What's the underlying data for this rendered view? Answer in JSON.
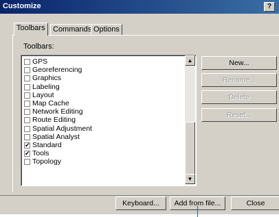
{
  "window": {
    "title": "Customize",
    "help_label": "?"
  },
  "tabs": [
    {
      "label": "Toolbars",
      "active": true
    },
    {
      "label": "Commands",
      "active": false
    },
    {
      "label": "Options",
      "active": false
    }
  ],
  "toolbars_label": "Toolbars:",
  "toolbar_items": [
    {
      "label": "GPS",
      "checked": false
    },
    {
      "label": "Georeferencing",
      "checked": false
    },
    {
      "label": "Graphics",
      "checked": false
    },
    {
      "label": "Labeling",
      "checked": false
    },
    {
      "label": "Layout",
      "checked": false
    },
    {
      "label": "Map Cache",
      "checked": false
    },
    {
      "label": "Network Editing",
      "checked": false
    },
    {
      "label": "Route Editing",
      "checked": false
    },
    {
      "label": "Spatial Adjustment",
      "checked": false
    },
    {
      "label": "Spatial Analyst",
      "checked": false
    },
    {
      "label": "Standard",
      "checked": true
    },
    {
      "label": "Tools",
      "checked": true
    },
    {
      "label": "Topology",
      "checked": false
    }
  ],
  "scrollbar": {
    "up": "▲",
    "down": "▼"
  },
  "side_buttons": {
    "new": "New...",
    "rename": "Rename...",
    "delete": "Delete",
    "reset": "Reset..."
  },
  "bottom_buttons": {
    "keyboard": "Keyboard...",
    "add_from_file": "Add from file...",
    "close": "Close"
  },
  "check_mark": "✔"
}
